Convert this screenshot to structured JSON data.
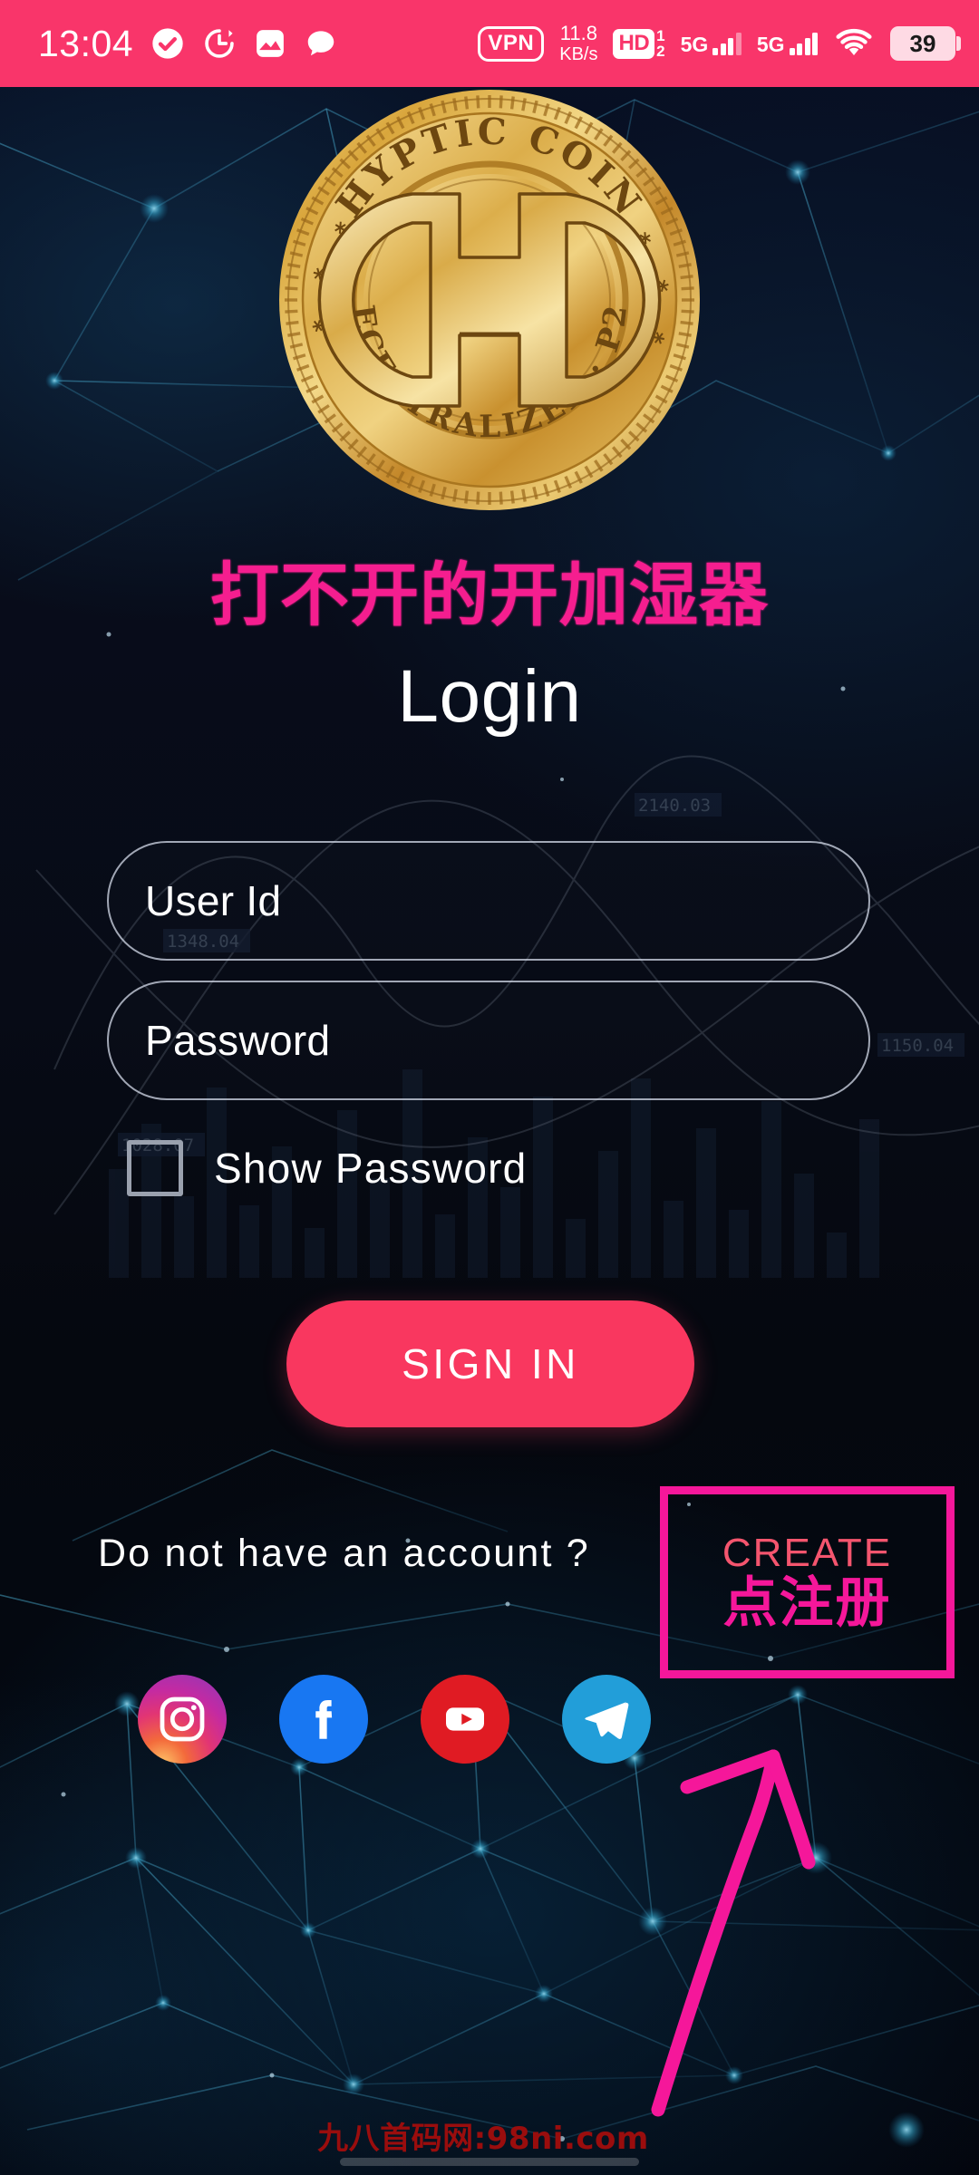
{
  "colors": {
    "statusbar_pink": "#f9356a",
    "accent_pink": "#f9375f",
    "magenta_annotation": "#f5179a",
    "create_text": "#f4556e",
    "background_navy": "#060a16",
    "watermark_red": "#9a0d0d"
  },
  "statusbar": {
    "time": "13:04",
    "left_icons": [
      "check-circle-icon",
      "timer-icon",
      "gallery-icon",
      "chat-bubble-icon"
    ],
    "vpn_label": "VPN",
    "network_speed_value": "11.8",
    "network_speed_unit": "KB/s",
    "hd_label": "HD",
    "hd_sim_top": "1",
    "hd_sim_bottom": "2",
    "sim1_network": "5G",
    "sim2_network": "5G",
    "wifi_icon": "wifi-icon",
    "battery_percent": "39"
  },
  "logo": {
    "name": "hyptic-coin-logo",
    "top_text": "HYPTIC COIN",
    "right_text": "P2P",
    "bottom_text": "DECENTRALIZED",
    "monogram": "H"
  },
  "overlay": {
    "brand_annotation_cn": "打不开的开加湿器"
  },
  "form": {
    "title": "Login",
    "userid_placeholder": "User Id",
    "userid_value": "",
    "password_placeholder": "Password",
    "password_value": "",
    "show_password_label": "Show Password",
    "show_password_checked": false,
    "signin_label": "SIGN IN"
  },
  "footer": {
    "account_question": "Do not have an account ?",
    "create_label": "CREATE",
    "create_annotation_cn": "点注册",
    "socials": [
      {
        "name": "instagram-icon",
        "label": "Instagram"
      },
      {
        "name": "facebook-icon",
        "label": "Facebook"
      },
      {
        "name": "youtube-icon",
        "label": "YouTube"
      },
      {
        "name": "telegram-icon",
        "label": "Telegram"
      }
    ]
  },
  "watermark": {
    "text": "九八首码网:98ni.com"
  },
  "background_chart": {
    "labels": [
      "2140.03",
      "1348.04",
      "1150.04",
      "1028.07"
    ]
  }
}
